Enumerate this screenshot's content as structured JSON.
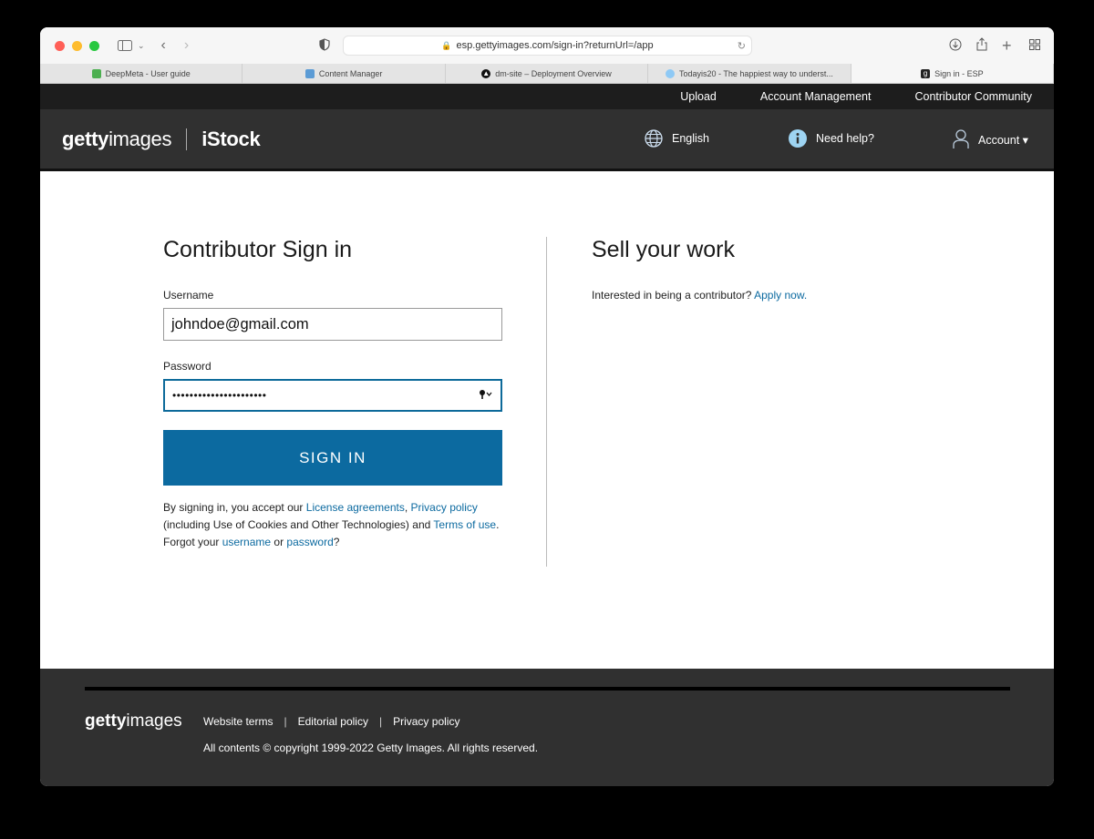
{
  "browser": {
    "url": "esp.gettyimages.com/sign-in?returnUrl=/app",
    "tabs": [
      {
        "title": "DeepMeta - User guide",
        "active": false
      },
      {
        "title": "Content Manager",
        "active": false
      },
      {
        "title": "dm-site – Deployment Overview",
        "active": false
      },
      {
        "title": "Todayis20 - The happiest way to underst...",
        "active": false
      },
      {
        "title": "Sign in - ESP",
        "active": true
      }
    ]
  },
  "topnav": {
    "upload": "Upload",
    "account_management": "Account Management",
    "contributor_community": "Contributor Community"
  },
  "brand": {
    "logo_bold": "getty",
    "logo_light": "images",
    "istock": "iStock",
    "language": "English",
    "help": "Need help?",
    "account": "Account ▾"
  },
  "signin": {
    "title": "Contributor Sign in",
    "username_label": "Username",
    "username_value": "johndoe@gmail.com",
    "password_label": "Password",
    "password_value": "••••••••••••••••••••••",
    "button": "SIGN IN",
    "legal_1": "By signing in, you accept our ",
    "license_link": "License agreements",
    "comma": ", ",
    "privacy_link": "Privacy policy",
    "legal_2": " (including Use of Cookies and Other Technologies) and ",
    "terms_link": "Terms of use",
    "period": ".",
    "forgot_1": "Forgot your ",
    "username_link": "username",
    "or": " or ",
    "password_link": "password",
    "question": "?"
  },
  "sell": {
    "title": "Sell your work",
    "text": "Interested in being a contributor? ",
    "apply_link": "Apply now."
  },
  "footer": {
    "logo_bold": "getty",
    "logo_light": "images",
    "website_terms": "Website terms",
    "editorial_policy": "Editorial policy",
    "privacy_policy": "Privacy policy",
    "copyright": "All contents © copyright 1999-2022 Getty Images. All rights reserved.",
    "separator": "|"
  },
  "colors": {
    "accent": "#0c6aa0",
    "nav_dark": "#1d1d1d",
    "brand_bar": "#303030"
  }
}
